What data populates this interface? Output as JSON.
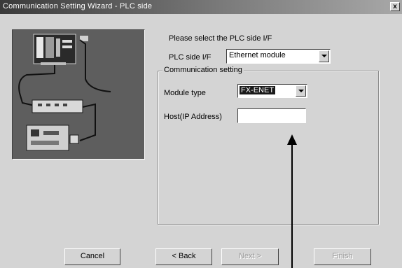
{
  "window": {
    "title": "Communication Setting Wizard - PLC side",
    "close_label": "x"
  },
  "prompt": "Please select the PLC side I/F",
  "plc_side_if": {
    "label": "PLC side I/F",
    "value": "Ethernet module"
  },
  "communication_setting": {
    "legend": "Communication setting",
    "module_type": {
      "label": "Module type",
      "value": "FX-ENET"
    },
    "host": {
      "label": "Host(IP Address)",
      "value": ""
    }
  },
  "buttons": {
    "cancel": "Cancel",
    "back": "< Back",
    "next": "Next >",
    "finish": "Finish"
  },
  "colors": {
    "titlebar_start": "#3a3a3a",
    "face": "#d4d4d4",
    "image_bg": "#5e5e5e"
  }
}
